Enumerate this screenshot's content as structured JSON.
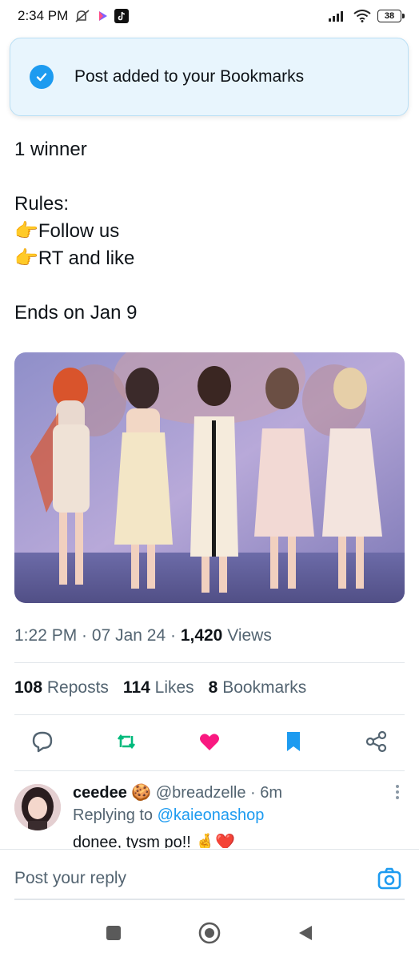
{
  "status_bar": {
    "time": "2:34 PM",
    "battery": "38"
  },
  "toast": {
    "message": "Post added to your Bookmarks"
  },
  "tweet": {
    "line1": "1 winner",
    "rules_title": "Rules:",
    "rule1_emoji": "👉",
    "rule1": "Follow us",
    "rule2_emoji": "👉",
    "rule2": "RT and like",
    "ends": "Ends on Jan 9",
    "time": "1:22 PM",
    "sep": " · ",
    "date": "07 Jan 24",
    "views_count": "1,420",
    "views_label": " Views"
  },
  "stats": {
    "reposts_count": "108",
    "reposts_label": " Reposts",
    "likes_count": "114",
    "likes_label": " Likes",
    "bookmarks_count": "8",
    "bookmarks_label": " Bookmarks"
  },
  "reply": {
    "name": "ceedee",
    "name_emoji": "🍪",
    "handle": "@breadzelle",
    "time": " · 6m",
    "replying_prefix": "Replying to ",
    "replying_to": "@kaieonashop",
    "body": "donee, tysm po!! 🤞❤️"
  },
  "composer": {
    "placeholder": "Post your reply"
  },
  "icons": {
    "reply": "comment-icon",
    "repost": "repost-icon",
    "like": "heart-icon",
    "bookmark": "bookmark-icon",
    "share": "share-icon",
    "camera": "camera-icon"
  },
  "colors": {
    "accent": "#1d9bf0",
    "repost": "#00ba7c",
    "like": "#f91880",
    "toast_bg": "#e8f5fd",
    "muted": "#536471"
  }
}
